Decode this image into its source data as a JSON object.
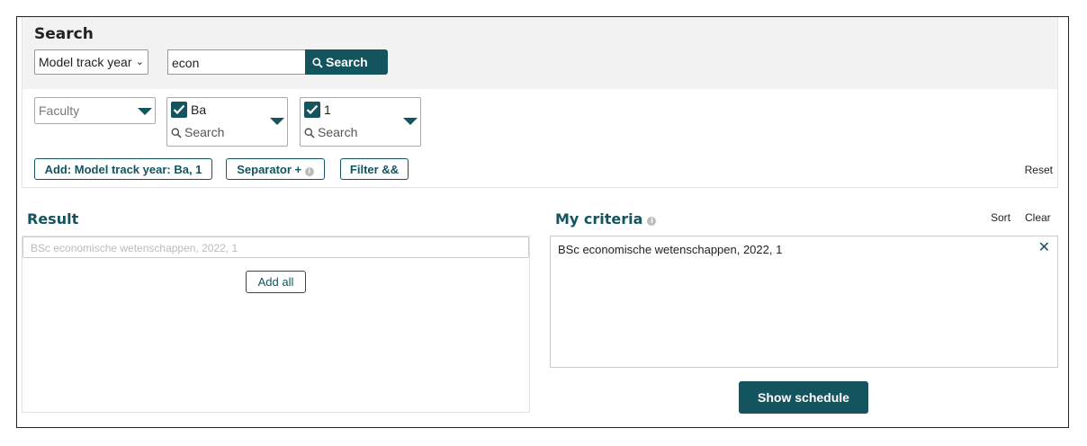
{
  "search": {
    "title": "Search",
    "type_select": "Model track year",
    "query": "econ",
    "button_label": "Search"
  },
  "filters": {
    "faculty_placeholder": "Faculty",
    "level": {
      "checked_label": "Ba",
      "search_placeholder": "Search"
    },
    "year": {
      "checked_label": "1",
      "search_placeholder": "Search"
    }
  },
  "actions": {
    "add_label": "Add: Model track year: Ba, 1",
    "separator_label": "Separator +",
    "filter_label": "Filter &&",
    "reset_label": "Reset"
  },
  "result": {
    "title": "Result",
    "item": "BSc economische wetenschappen, 2022, 1",
    "add_all_label": "Add all"
  },
  "criteria": {
    "title": "My criteria",
    "sort_label": "Sort",
    "clear_label": "Clear",
    "items": [
      "BSc economische wetenschappen, 2022, 1"
    ],
    "remove_symbol": "✕"
  },
  "show_schedule_label": "Show schedule",
  "icons": {
    "search": "search-icon",
    "info": "info-icon",
    "check": "check-icon",
    "dropdown": "dropdown-arrow-icon",
    "remove": "close-icon"
  },
  "colors": {
    "accent": "#14545e",
    "panel_bg": "#f2f2f2"
  }
}
